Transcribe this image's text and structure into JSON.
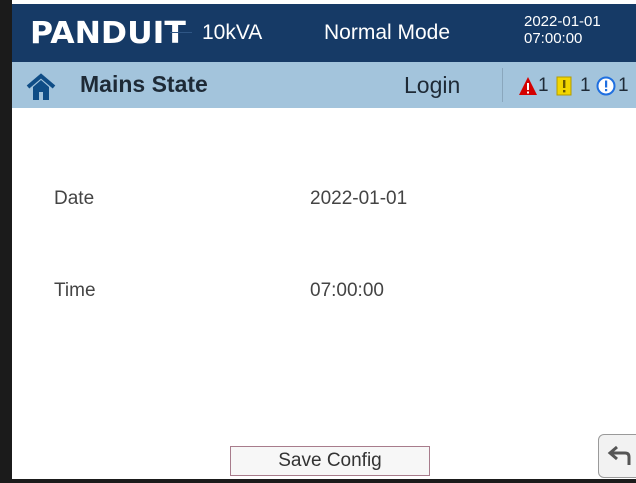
{
  "header": {
    "brand": "PANDUIT",
    "power_rating": "10kVA",
    "mode": "Normal Mode",
    "date": "2022-01-01",
    "time": "07:00:00"
  },
  "subheader": {
    "title": "Mains State",
    "login_label": "Login",
    "alarms": [
      {
        "icon": "warning-triangle-icon",
        "count": "1",
        "color": "#cc0000"
      },
      {
        "icon": "exclamation-box-icon",
        "count": "1",
        "color": "#e6c200"
      },
      {
        "icon": "info-circle-icon",
        "count": "1",
        "color": "#1f6fe0"
      }
    ]
  },
  "form": {
    "date_label": "Date",
    "date_value": "2022-01-01",
    "time_label": "Time",
    "time_value": "07:00:00"
  },
  "actions": {
    "save_label": "Save Config",
    "back_icon": "back-arrow-icon"
  }
}
